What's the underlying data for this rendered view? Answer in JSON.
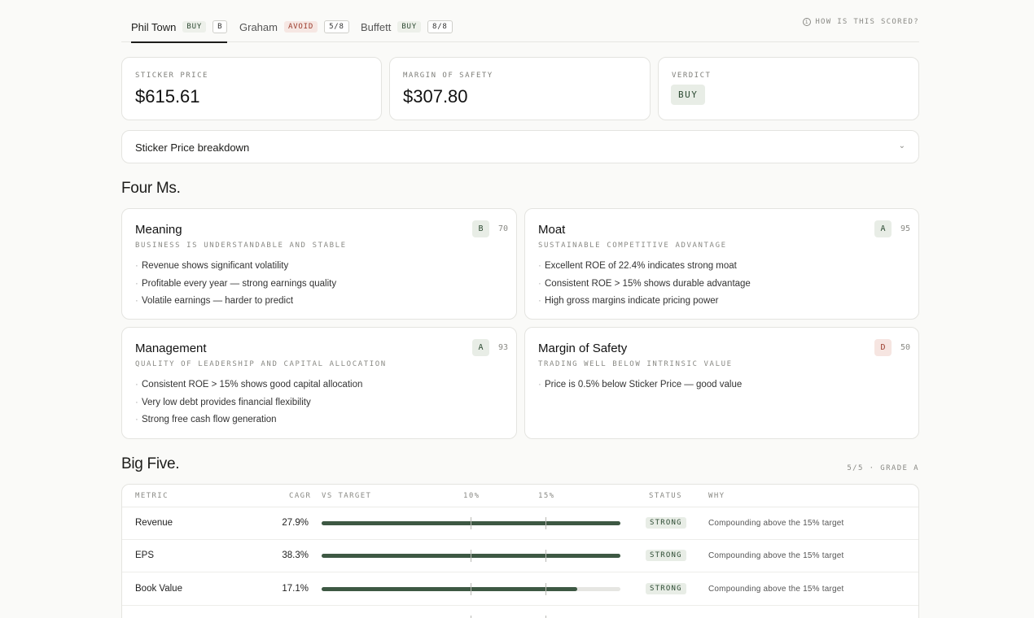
{
  "tabs": [
    {
      "label": "Phil Town",
      "verdict": "BUY",
      "score": "B"
    },
    {
      "label": "Graham",
      "verdict": "AVOID",
      "score": "5/8"
    },
    {
      "label": "Buffett",
      "verdict": "BUY",
      "score": "8/8"
    }
  ],
  "how_scored": "HOW IS THIS SCORED?",
  "stats": {
    "sticker_label": "STICKER PRICE",
    "sticker_value": "$615.61",
    "mos_label": "MARGIN OF SAFETY",
    "mos_value": "$307.80",
    "verdict_label": "VERDICT",
    "verdict_value": "BUY"
  },
  "breakdown_label": "Sticker Price breakdown",
  "four_ms": {
    "title": "Four Ms.",
    "cards": [
      {
        "title": "Meaning",
        "subtitle": "BUSINESS IS UNDERSTANDABLE AND STABLE",
        "grade": "B",
        "score": "70",
        "points": [
          "Revenue shows significant volatility",
          "Profitable every year — strong earnings quality",
          "Volatile earnings — harder to predict"
        ]
      },
      {
        "title": "Moat",
        "subtitle": "SUSTAINABLE COMPETITIVE ADVANTAGE",
        "grade": "A",
        "score": "95",
        "points": [
          "Excellent ROE of 22.4% indicates strong moat",
          "Consistent ROE > 15% shows durable advantage",
          "High gross margins indicate pricing power"
        ]
      },
      {
        "title": "Management",
        "subtitle": "QUALITY OF LEADERSHIP AND CAPITAL ALLOCATION",
        "grade": "A",
        "score": "93",
        "points": [
          "Consistent ROE > 15% shows good capital allocation",
          "Very low debt provides financial flexibility",
          "Strong free cash flow generation"
        ]
      },
      {
        "title": "Margin of Safety",
        "subtitle": "TRADING WELL BELOW INTRINSIC VALUE",
        "grade": "D",
        "score": "50",
        "points": [
          "Price is 0.5% below Sticker Price — good value"
        ]
      }
    ]
  },
  "big_five": {
    "title": "Big Five.",
    "meta": "5/5 · GRADE A",
    "headers": {
      "metric": "METRIC",
      "cagr": "CAGR",
      "vs_target": "VS TARGET",
      "t10": "10%",
      "t15": "15%",
      "status": "STATUS",
      "why": "WHY"
    },
    "rows": [
      {
        "metric": "Revenue",
        "cagr": "27.9%",
        "fill": 1.0,
        "status": "STRONG",
        "why": "Compounding above the 15% target"
      },
      {
        "metric": "EPS",
        "cagr": "38.3%",
        "fill": 1.0,
        "status": "STRONG",
        "why": "Compounding above the 15% target"
      },
      {
        "metric": "Book Value",
        "cagr": "17.1%",
        "fill": 0.855,
        "status": "STRONG",
        "why": "Compounding above the 15% target"
      }
    ]
  }
}
